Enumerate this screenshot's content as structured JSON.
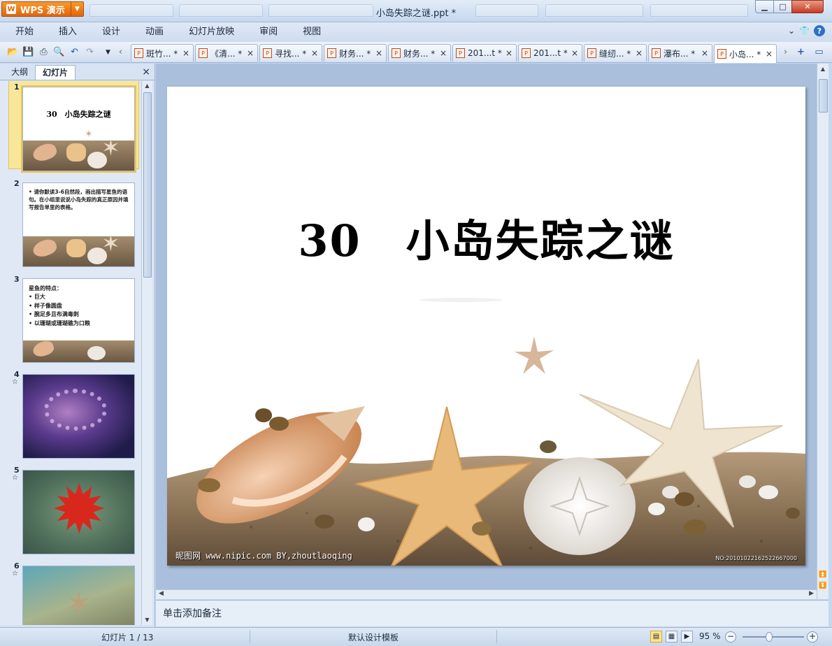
{
  "app": {
    "name": "WPS 演示",
    "window_title": "小岛失踪之谜.ppt *"
  },
  "window_controls": {
    "minimize": "▁",
    "maximize": "□",
    "close": "✕"
  },
  "menu": [
    "开始",
    "插入",
    "设计",
    "动画",
    "幻灯片放映",
    "审阅",
    "视图"
  ],
  "menu_right": {
    "collapse": "⌄",
    "skin": "👕",
    "help": "?"
  },
  "toolbar_icons": [
    "open-icon",
    "save-icon",
    "print-icon",
    "print-preview-icon",
    "undo-icon",
    "redo-icon",
    "more-icon",
    "scroll-tabs-left-icon"
  ],
  "doc_tabs": [
    {
      "label": "斑竹... *",
      "active": false
    },
    {
      "label": "《清... *",
      "active": false
    },
    {
      "label": "寻找... *",
      "active": false
    },
    {
      "label": "财务... *",
      "active": false
    },
    {
      "label": "财务... *",
      "active": false
    },
    {
      "label": "201...t *",
      "active": false
    },
    {
      "label": "201...t *",
      "active": false
    },
    {
      "label": "缝纫... *",
      "active": false
    },
    {
      "label": "瀑布... *",
      "active": false
    },
    {
      "label": "小岛... *",
      "active": true
    }
  ],
  "tab_close": "×",
  "panel": {
    "tabs": [
      "大纲",
      "幻灯片"
    ],
    "active_tab": "幻灯片",
    "close": "×"
  },
  "thumbnails": [
    {
      "num": "1",
      "title": "30　小岛失踪之谜"
    },
    {
      "num": "2",
      "text": "• 请你默读3-6自然段，画出描写星鱼的语句。在小组里说说小岛失踪的真正原因并填写报告单里的表格。"
    },
    {
      "num": "3",
      "lines": [
        "星鱼的特点：",
        "• 巨大",
        "• 样子像圆盘",
        "• 腕足多且布满毒刺",
        "• 以珊瑚或珊瑚礁为口粮"
      ]
    },
    {
      "num": "4",
      "star": "☆"
    },
    {
      "num": "5",
      "star": "☆"
    },
    {
      "num": "6",
      "star": "☆"
    }
  ],
  "slide": {
    "title": "30　小岛失踪之谜",
    "watermark": "昵图网 www.nipic.com    BY,zhoutlaoqing",
    "watermark_id": "NO:20101022162522667000"
  },
  "notes_placeholder": "单击添加备注",
  "status": {
    "slide_indicator": "幻灯片 1 / 13",
    "template": "默认设计模板",
    "zoom": "95 %",
    "zoom_level": 0.95
  },
  "colors": {
    "wps_orange": "#e0650e",
    "chrome_blue": "#c7d7ec",
    "stage_blue": "#a9bfdb",
    "selected_thumb": "#f8e79a"
  }
}
